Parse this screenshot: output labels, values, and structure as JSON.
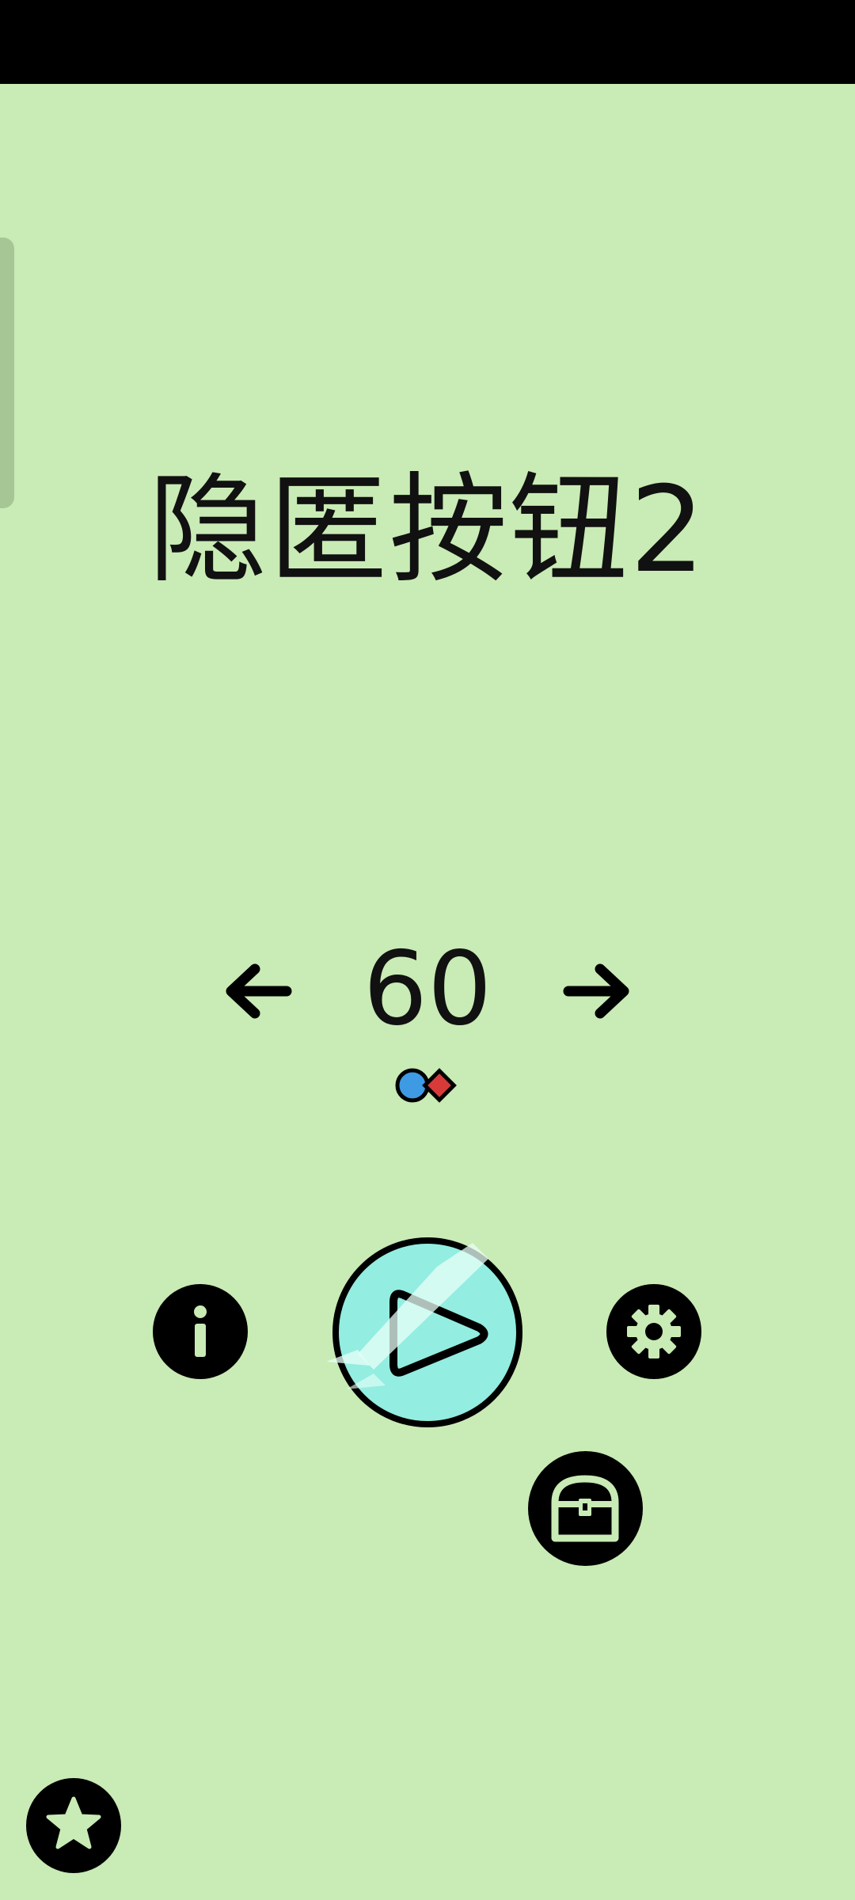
{
  "title": "隐匿按钮2",
  "level": {
    "number": "60",
    "prev_icon": "arrow-left-icon",
    "next_icon": "arrow-right-icon"
  },
  "mode_icons": [
    "blue-circle-icon",
    "red-diamond-icon"
  ],
  "buttons": {
    "info_icon": "info-icon",
    "play_icon": "play-icon",
    "settings_icon": "gear-icon",
    "chest_icon": "treasure-chest-icon",
    "star_icon": "star-icon"
  },
  "colors": {
    "background": "#c9ebb5",
    "play_fill": "#93ede0",
    "mode_blue": "#3d9ae3",
    "mode_red": "#d83a3a"
  }
}
